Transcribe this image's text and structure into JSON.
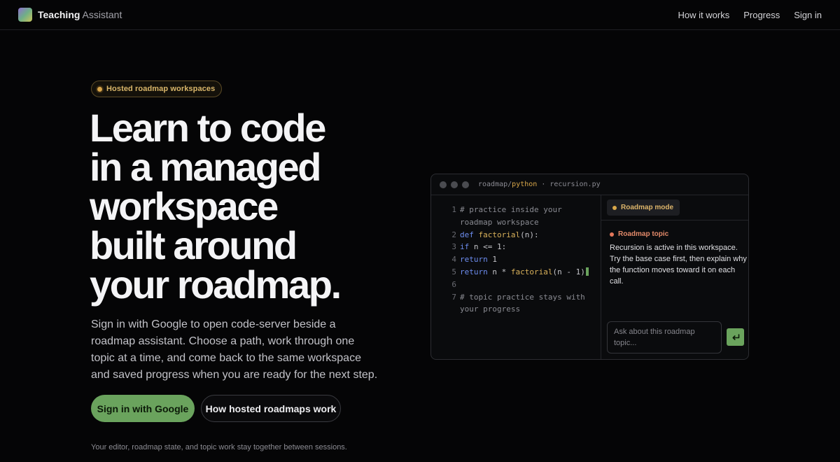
{
  "nav": {
    "brand_bold": "Teaching",
    "brand_light": "Assistant",
    "links": [
      "How it works",
      "Progress",
      "Sign in"
    ]
  },
  "hero": {
    "badge": "Hosted roadmap workspaces",
    "headline_lines": [
      "Learn to code",
      "in a managed",
      "workspace",
      "built around",
      "your roadmap."
    ],
    "lede": "Sign in with Google to open code-server beside a roadmap assistant. Choose a path, work through one topic at a time, and come back to the same workspace and saved progress when you are ready for the next step.",
    "primary_cta": "Sign in with Google",
    "secondary_cta": "How hosted roadmaps work",
    "footnote": "Your editor, roadmap state, and topic work stay together between sessions."
  },
  "editor": {
    "path_prefix": "roadmap/",
    "path_lang": "python",
    "path_sep": " · ",
    "file": "recursion.py",
    "lines": [
      {
        "n": "1",
        "segments": [
          {
            "t": "# practice inside your roadmap workspace",
            "c": "comment"
          }
        ]
      },
      {
        "n": "2",
        "segments": [
          {
            "t": "def ",
            "c": "kw"
          },
          {
            "t": "factorial",
            "c": "fn"
          },
          {
            "t": "(n):",
            "c": "plain"
          }
        ]
      },
      {
        "n": "3",
        "segments": [
          {
            "t": "if",
            "c": "kw"
          },
          {
            "t": " n <= 1:",
            "c": "plain"
          }
        ]
      },
      {
        "n": "4",
        "segments": [
          {
            "t": "return",
            "c": "kw"
          },
          {
            "t": " 1",
            "c": "plain"
          }
        ]
      },
      {
        "n": "5",
        "segments": [
          {
            "t": "return",
            "c": "kw"
          },
          {
            "t": " n * ",
            "c": "plain"
          },
          {
            "t": "factorial",
            "c": "fn"
          },
          {
            "t": "(n - 1)",
            "c": "plain"
          }
        ],
        "caret": true
      },
      {
        "n": "6",
        "segments": []
      },
      {
        "n": "7",
        "segments": [
          {
            "t": "# topic practice stays with your progress",
            "c": "comment"
          }
        ]
      }
    ],
    "mode_label": "Roadmap mode",
    "topic_label": "Roadmap topic",
    "topic_body": "Recursion is active in this workspace. Try the base case first, then explain why the function moves toward it on each call.",
    "ask_placeholder": "Ask about this roadmap topic...",
    "send_icon": "enter-icon"
  },
  "colors": {
    "accent_green": "#6aa35d",
    "accent_amber": "#d9a84a",
    "accent_coral": "#e3765a",
    "background": "#050506"
  }
}
